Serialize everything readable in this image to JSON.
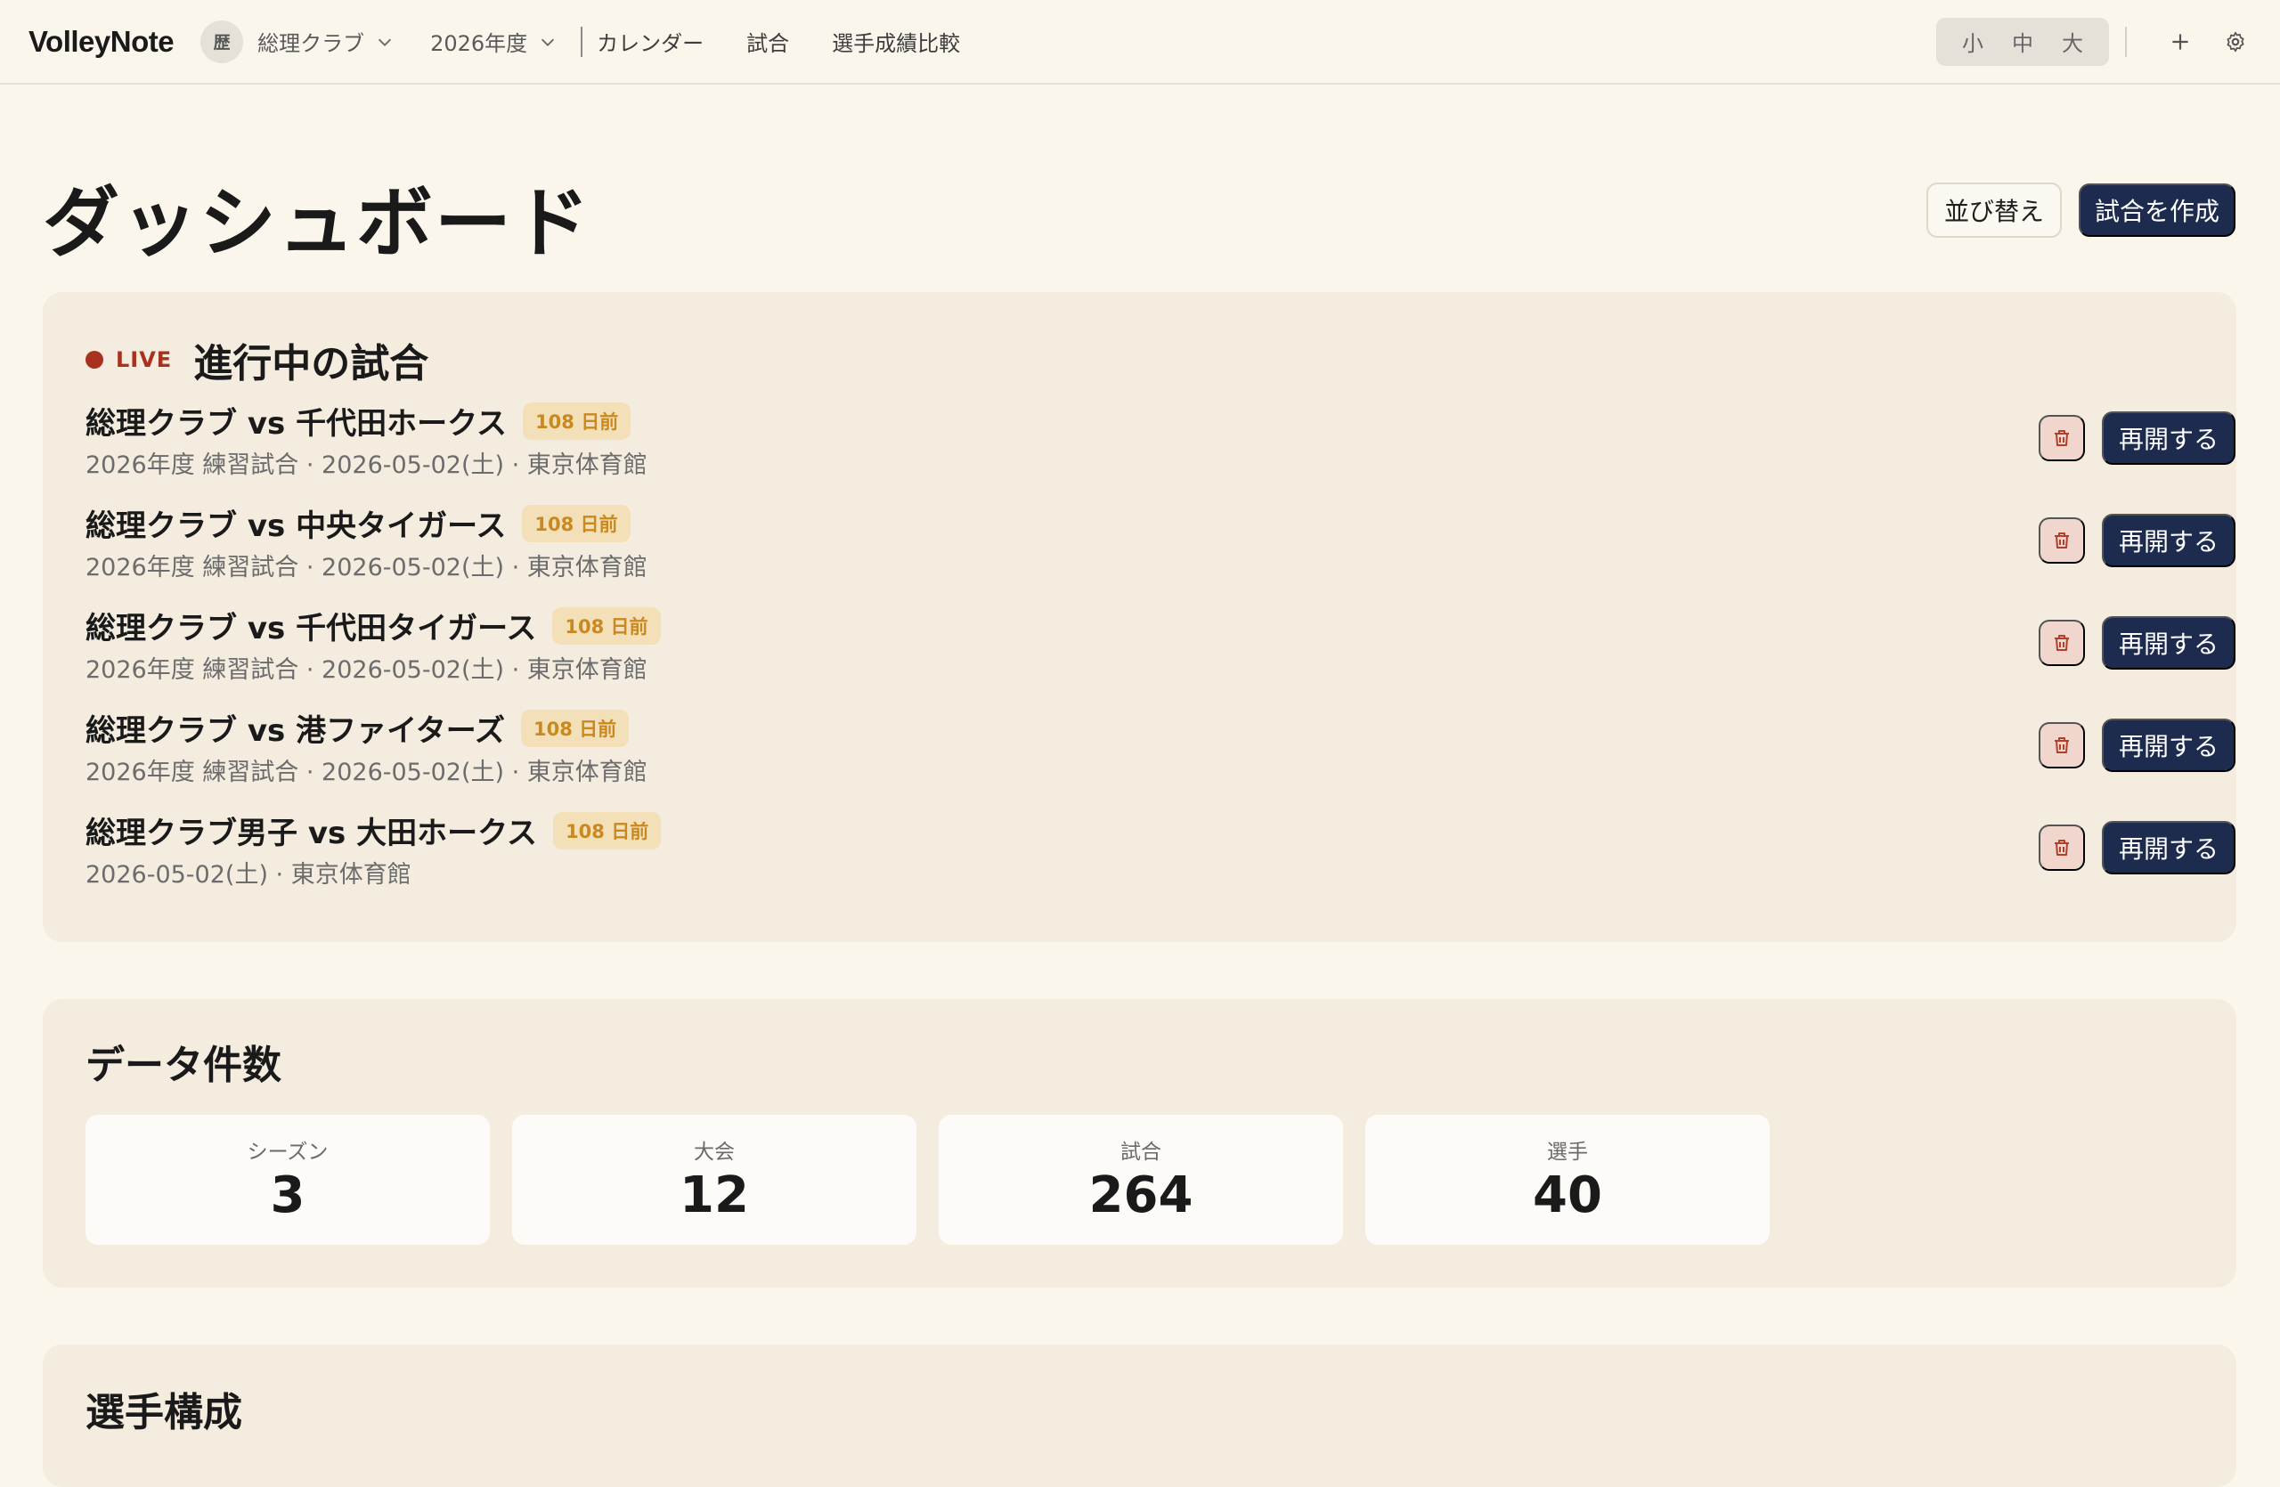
{
  "header": {
    "brand": "VolleyNote",
    "team_avatar_text": "歴",
    "team_name": "総理クラブ",
    "season": "2026年度",
    "nav": [
      "カレンダー",
      "試合",
      "選手成績比較"
    ],
    "text_size": [
      "小",
      "中",
      "大"
    ],
    "icons": [
      "chevron-down-icon",
      "plus-icon",
      "gear-icon"
    ]
  },
  "page": {
    "title": "ダッシュボード",
    "sort_label": "並び替え",
    "create_label": "試合を作成"
  },
  "live": {
    "tag": "LIVE",
    "title": "進行中の試合",
    "resume_label": "再開する",
    "matches": [
      {
        "name": "総理クラブ vs 千代田ホークス",
        "badge": "108 日前",
        "meta": "2026年度 練習試合 · 2026-05-02(土) · 東京体育館"
      },
      {
        "name": "総理クラブ vs 中央タイガース",
        "badge": "108 日前",
        "meta": "2026年度 練習試合 · 2026-05-02(土) · 東京体育館"
      },
      {
        "name": "総理クラブ vs 千代田タイガース",
        "badge": "108 日前",
        "meta": "2026年度 練習試合 · 2026-05-02(土) · 東京体育館"
      },
      {
        "name": "総理クラブ vs 港ファイターズ",
        "badge": "108 日前",
        "meta": "2026年度 練習試合 · 2026-05-02(土) · 東京体育館"
      },
      {
        "name": "総理クラブ男子 vs 大田ホークス",
        "badge": "108 日前",
        "meta": "2026-05-02(土) · 東京体育館"
      }
    ]
  },
  "stats": {
    "title": "データ件数",
    "items": [
      {
        "label": "シーズン",
        "value": "3"
      },
      {
        "label": "大会",
        "value": "12"
      },
      {
        "label": "試合",
        "value": "264"
      },
      {
        "label": "選手",
        "value": "40"
      }
    ]
  },
  "roster": {
    "title": "選手構成"
  },
  "colors": {
    "primary": "#1d2b4f",
    "live": "#a8321f",
    "badge_bg": "#f3e0b8",
    "badge_text": "#c9891f",
    "background": "#faf6ec",
    "panel": "#f3ecdf"
  }
}
